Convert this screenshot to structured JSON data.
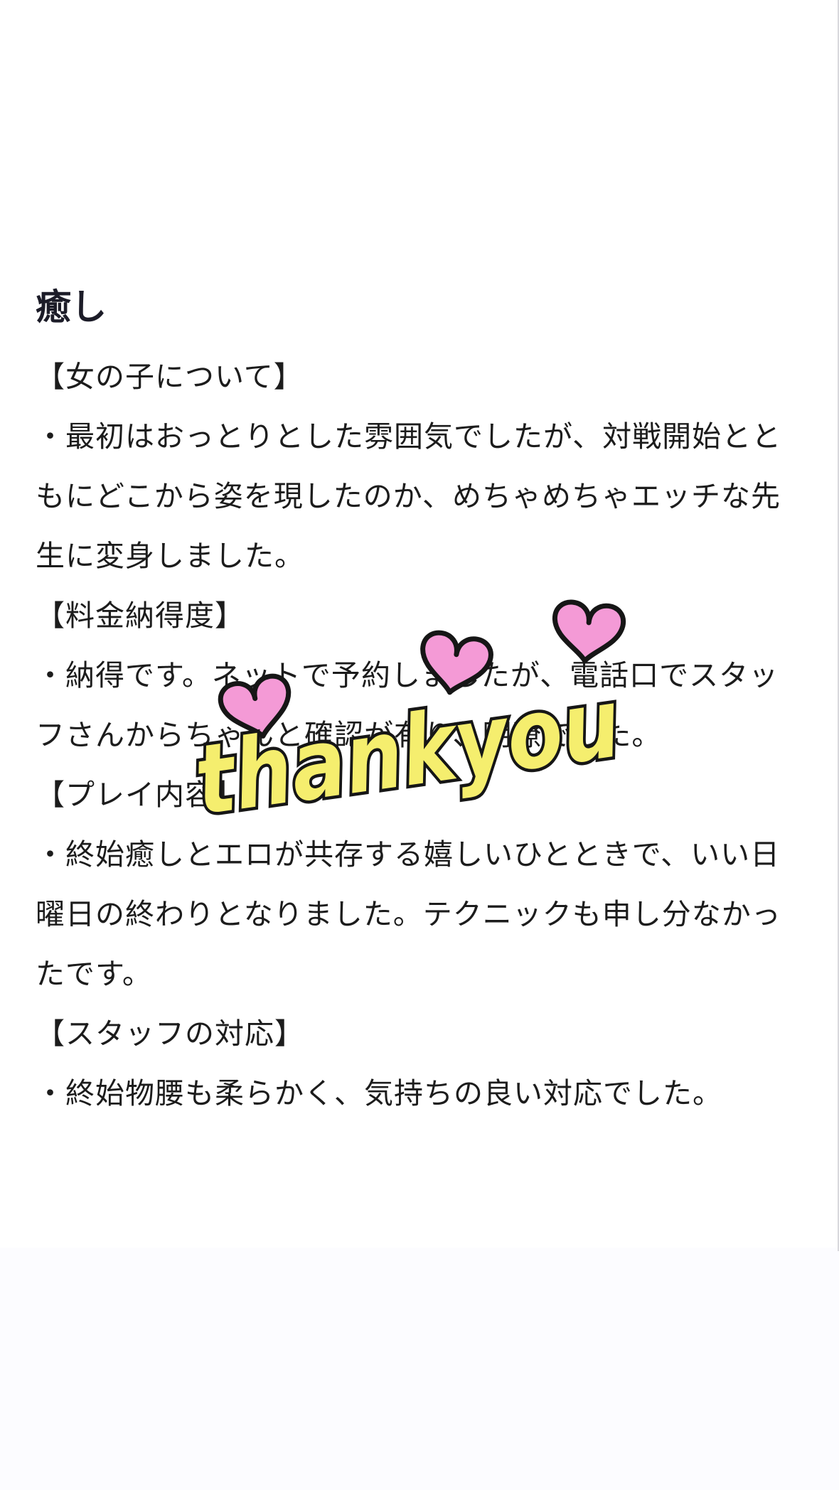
{
  "review": {
    "title": "癒し",
    "sections": [
      {
        "heading": "【女の子について】",
        "text": "・最初はおっとりとした雰囲気でしたが、対戦開始とともにどこから姿を現したのか、めちゃめちゃエッチな先生に変身しました。"
      },
      {
        "heading": "【料金納得度】",
        "text": "・納得です。ネットで予約しましたが、電話口でスタッフさんからちゃんと確認が有り、明瞭でした。"
      },
      {
        "heading": "【プレイ内容】",
        "text": "・終始癒しとエロが共存する嬉しいひとときで、いい日曜日の終わりとなりました。テクニックも申し分なかったです。"
      },
      {
        "heading": "【スタッフの対応】",
        "text": "・終始物腰も柔らかく、気持ちの良い対応でした。"
      }
    ]
  },
  "sticker": {
    "text": "thankyou",
    "icon": "hearts",
    "text_color": "#f5ee6e",
    "outline_color": "#161616",
    "heart_color": "#f49ad6"
  },
  "colors": {
    "background": "#ffffff",
    "text": "#1c1c1c"
  }
}
